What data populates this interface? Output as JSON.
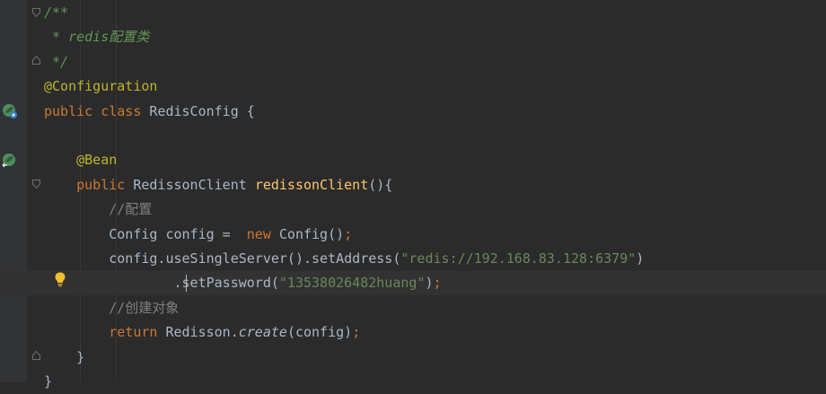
{
  "editor": {
    "lines": [
      {
        "tokens": [
          {
            "t": "/**",
            "c": "tok-comment-doc"
          }
        ]
      },
      {
        "tokens": [
          {
            "t": " * redis配置类",
            "c": "tok-comment-doc"
          }
        ]
      },
      {
        "tokens": [
          {
            "t": " */",
            "c": "tok-comment-doc"
          }
        ]
      },
      {
        "tokens": [
          {
            "t": "@Configuration",
            "c": "tok-annotation"
          }
        ]
      },
      {
        "tokens": [
          {
            "t": "public class ",
            "c": "tok-keyword"
          },
          {
            "t": "RedisConfig {",
            "c": "tok-plain"
          }
        ]
      },
      {
        "tokens": []
      },
      {
        "tokens": [
          {
            "t": "    ",
            "c": "tok-plain"
          },
          {
            "t": "@Bean",
            "c": "tok-annotation"
          }
        ]
      },
      {
        "tokens": [
          {
            "t": "    ",
            "c": "tok-plain"
          },
          {
            "t": "public ",
            "c": "tok-keyword"
          },
          {
            "t": "RedissonClient ",
            "c": "tok-plain"
          },
          {
            "t": "redissonClient",
            "c": "tok-method-decl"
          },
          {
            "t": "(){",
            "c": "tok-plain"
          }
        ]
      },
      {
        "tokens": [
          {
            "t": "        ",
            "c": "tok-plain"
          },
          {
            "t": "//配置",
            "c": "tok-comment"
          }
        ]
      },
      {
        "tokens": [
          {
            "t": "        Config config =  ",
            "c": "tok-plain"
          },
          {
            "t": "new ",
            "c": "tok-keyword"
          },
          {
            "t": "Config()",
            "c": "tok-plain"
          },
          {
            "t": ";",
            "c": "tok-punct"
          }
        ]
      },
      {
        "tokens": [
          {
            "t": "        config.useSingleServer().setAddress(",
            "c": "tok-plain"
          },
          {
            "t": "\"redis://192.168.83.128:6379\"",
            "c": "tok-string"
          },
          {
            "t": ")",
            "c": "tok-plain"
          }
        ]
      },
      {
        "tokens": [
          {
            "t": "                ",
            "c": "tok-plain"
          },
          {
            "t": ".setPassword(",
            "c": "tok-plain"
          },
          {
            "t": "\"13538026482huang\"",
            "c": "tok-string"
          },
          {
            "t": ")",
            "c": "tok-plain"
          },
          {
            "t": ";",
            "c": "tok-punct"
          }
        ],
        "current": true
      },
      {
        "tokens": [
          {
            "t": "        ",
            "c": "tok-plain"
          },
          {
            "t": "//创建对象",
            "c": "tok-comment"
          }
        ]
      },
      {
        "tokens": [
          {
            "t": "        ",
            "c": "tok-plain"
          },
          {
            "t": "return ",
            "c": "tok-keyword"
          },
          {
            "t": "Redisson.",
            "c": "tok-plain"
          },
          {
            "t": "create",
            "c": "tok-static"
          },
          {
            "t": "(config)",
            "c": "tok-plain"
          },
          {
            "t": ";",
            "c": "tok-punct"
          }
        ]
      },
      {
        "tokens": [
          {
            "t": "    }",
            "c": "tok-plain"
          }
        ]
      },
      {
        "tokens": [
          {
            "t": "}",
            "c": "tok-plain"
          }
        ]
      }
    ]
  },
  "gutter_icons": {
    "config_bean_icon": "spring-bean-icon",
    "bean_method_icon": "spring-bean-method-icon",
    "intention_icon": "lightbulb-icon"
  },
  "colors": {
    "background": "#2b2b2b",
    "keyword": "#cc7832",
    "annotation": "#bbb529",
    "string": "#6a8759",
    "doc_comment": "#629755",
    "method_declaration": "#ffc66d"
  }
}
